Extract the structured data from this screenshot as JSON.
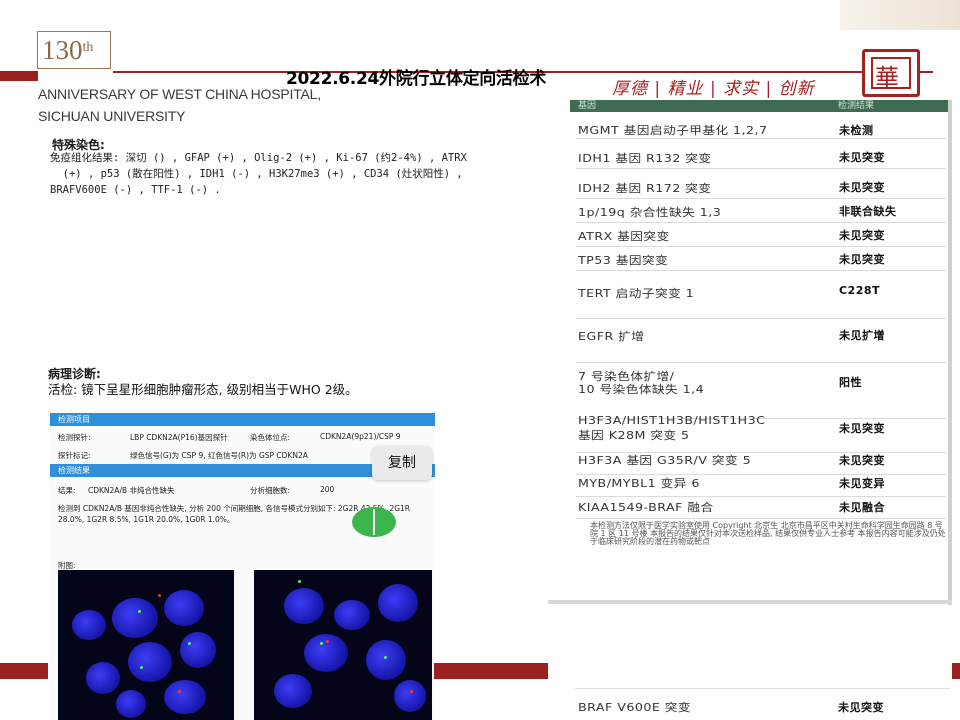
{
  "header": {
    "logo_number": "130",
    "logo_suffix": "th",
    "anniversary_line1": "ANNIVERSARY OF WEST CHINA HOSPITAL,",
    "anniversary_line2": "SICHUAN UNIVERSITY",
    "title": "2022.6.24外院行立体定向活检术",
    "motto": "厚德 | 精业 | 求实 | 创新",
    "colors": {
      "brand_red": "#9b2020",
      "logo_gold": "#8b6a45"
    }
  },
  "special_stain": {
    "heading": "特殊染色:",
    "body": "免疫组化结果: 深切 () , GFAP (+) , Olig-2 (+) , Ki-67 (约2-4%) , ATRX\n  (+) , p53 (散在阳性) , IDH1 (-) , H3K27me3 (+) , CD34 (灶状阳性) ,\nBRAFV600E (-) , TTF-1 (-) ."
  },
  "pathology": {
    "heading": "病理诊断:",
    "body": "活检: 镜下呈星形细胞肿瘤形态, 级别相当于WHO 2级。"
  },
  "fish_report": {
    "section_items": "检测项目",
    "probe_label": "检测探针:",
    "probe_value": "LBP CDKN2A(P16)基因探针",
    "locus_label": "染色体位点:",
    "locus_value": "CDKN2A(9p21)/CSP 9",
    "marker_label": "探针标记:",
    "marker_value": "绿色信号(G)为 CSP 9, 红色信号(R)为 GSP CDKN2A",
    "section_result": "检测结果",
    "result_label": "结果:",
    "result_value": "CDKN2A/B 非纯合性缺失",
    "cells_label": "分析细胞数:",
    "cells_value": "200",
    "description_1": "检测到 CDKN2A/B 基因非纯合性缺失, 分析 200 个间期细胞, 各信号模式分别如下: 2G2R 42.5%, 2G1R",
    "description_2": "28.0%, 1G2R 8.5%, 1G1R 20.0%, 1G0R 1.0%。",
    "figure_label": "附图:",
    "copy_button": "复制",
    "colors": {
      "section_bar": "#2f8fd8",
      "fab_green": "#3cb54a"
    }
  },
  "gene_table": {
    "header_gene": "基因",
    "header_result": "检测结果",
    "rows": [
      {
        "gene": "MGMT 基因启动子甲基化 1,2,7",
        "result": "未检测"
      },
      {
        "gene": "IDH1 基因 R132 突变",
        "result": "未见突变"
      },
      {
        "gene": "IDH2 基因 R172 突变",
        "result": "未见突变"
      },
      {
        "gene": "1p/19q 杂合性缺失 1,3",
        "result": "非联合缺失"
      },
      {
        "gene": "ATRX 基因突变",
        "result": "未见突变"
      },
      {
        "gene": "TP53 基因突变",
        "result": "未见突变"
      },
      {
        "gene": "TERT 启动子突变 1",
        "result": "C228T"
      },
      {
        "gene": "EGFR 扩增",
        "result": "未见扩增"
      },
      {
        "gene": "7 号染色体扩增/",
        "gene2": "10 号染色体缺失 1,4",
        "result": "阳性"
      },
      {
        "gene": "H3F3A/HIST1H3B/HIST1H3C",
        "gene2": "基因 K28M 突变 5",
        "result": "未见突变"
      },
      {
        "gene": "H3F3A 基因 G35R/V 突变 5",
        "result": "未见突变"
      },
      {
        "gene": "MYB/MYBL1 变异 6",
        "result": "未见变异"
      },
      {
        "gene": "KIAA1549-BRAF 融合",
        "result": "未见融合"
      }
    ],
    "footnote": "本检测方法仅限于医学实验室使用 Copyright 北京生 北京市昌平区中关村生命科学园生命园路 8 号院 1 区 11 号楼 本报告的结果仅针对本次送检样品, 结果仅供专业人士参考 本报告内容可能涉及仍处于临床研究阶段的潜在药物或靶点",
    "braf_gene": "BRAF V600E 突变",
    "braf_result": "未见突变"
  }
}
